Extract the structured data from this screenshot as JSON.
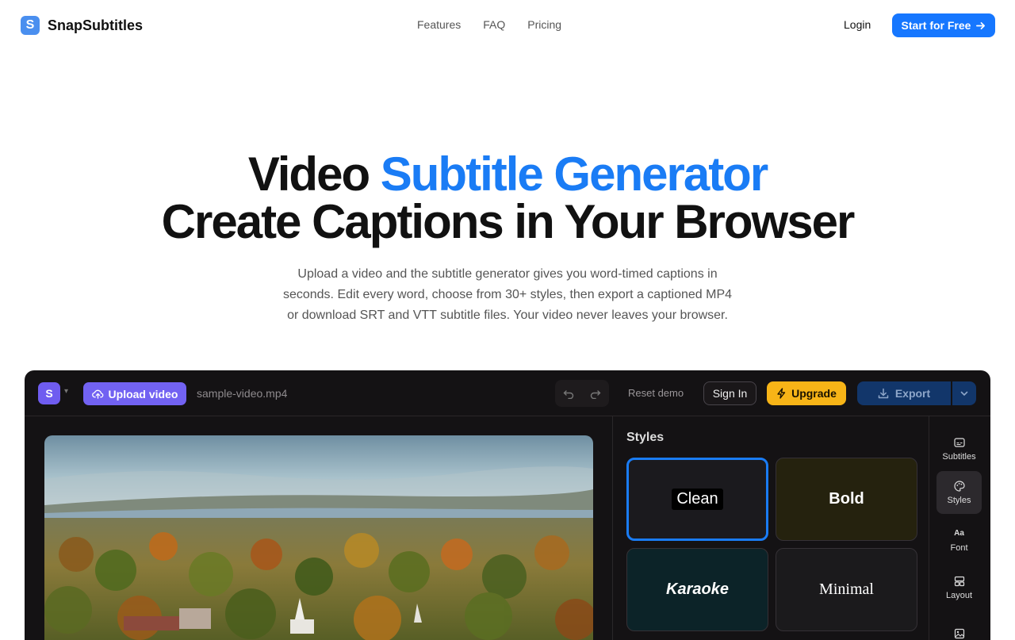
{
  "nav": {
    "brand_letter": "S",
    "brand_name": "SnapSubtitles",
    "links": [
      "Features",
      "FAQ",
      "Pricing"
    ],
    "login": "Login",
    "cta": "Start for Free",
    "cta_icon": "arrow-right-icon"
  },
  "hero": {
    "title_plain": "Video ",
    "title_accent": "Subtitle Generator",
    "title_line2": "Create Captions in Your Browser",
    "subtitle": "Upload a video and the subtitle generator gives you word-timed captions in seconds. Edit every word, choose from 30+ styles, then export a captioned MP4 or download SRT and VTT subtitle files. Your video never leaves your browser.",
    "accent_color": "#1a7cf5"
  },
  "app": {
    "workspace_letter": "S",
    "upload_label": "Upload video",
    "filename": "sample-video.mp4",
    "reset_label": "Reset demo",
    "signin_label": "Sign In",
    "upgrade_label": "Upgrade",
    "export_label": "Export",
    "styles_heading": "Styles",
    "styles": [
      {
        "label": "Clean",
        "selected": true
      },
      {
        "label": "Bold",
        "selected": false
      },
      {
        "label": "Karaoke",
        "selected": false
      },
      {
        "label": "Minimal",
        "selected": false
      }
    ],
    "rail": [
      {
        "label": "Subtitles",
        "icon": "subtitles-icon",
        "active": false
      },
      {
        "label": "Styles",
        "icon": "palette-icon",
        "active": true
      },
      {
        "label": "Font",
        "icon": "font-icon",
        "active": false
      },
      {
        "label": "Layout",
        "icon": "layout-icon",
        "active": false
      },
      {
        "label": "",
        "icon": "image-icon",
        "active": false
      }
    ]
  }
}
